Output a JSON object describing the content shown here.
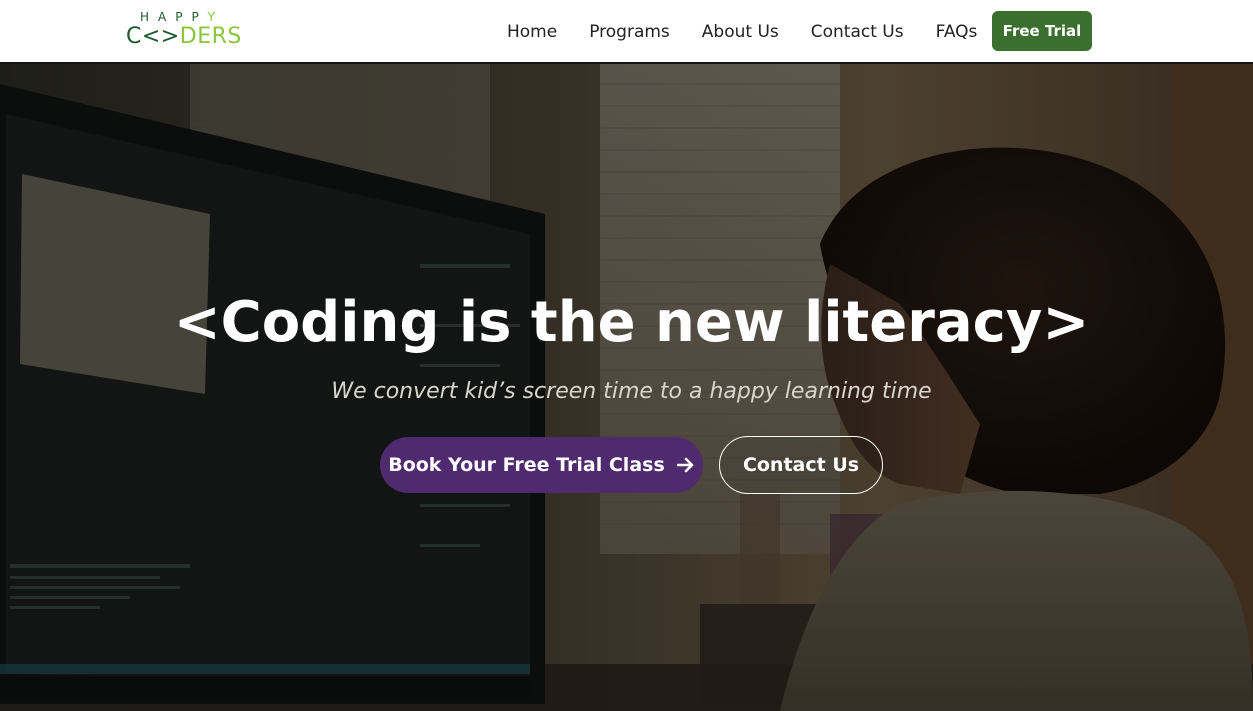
{
  "logo": {
    "top_text": "HAPPY",
    "bottom_c": "C",
    "bottom_brackets": "<>",
    "bottom_rest": "DERS"
  },
  "nav": {
    "links": [
      "Home",
      "Programs",
      "About Us",
      "Contact Us",
      "FAQs"
    ],
    "cta_label": "Free Trial"
  },
  "hero": {
    "title": "<Coding is the new literacy>",
    "subtitle": "We convert kid’s screen time to a happy learning time",
    "primary_button": "Book Your Free Trial Class",
    "secondary_button": "Contact Us"
  },
  "colors": {
    "brand_dark_green": "#1f5a2e",
    "brand_light_green": "#8cc63f",
    "cta_green": "#3b6f2f",
    "primary_purple": "#4f2a6e",
    "white": "#ffffff"
  },
  "icons": {
    "primary_button_icon": "arrow-right-icon"
  }
}
